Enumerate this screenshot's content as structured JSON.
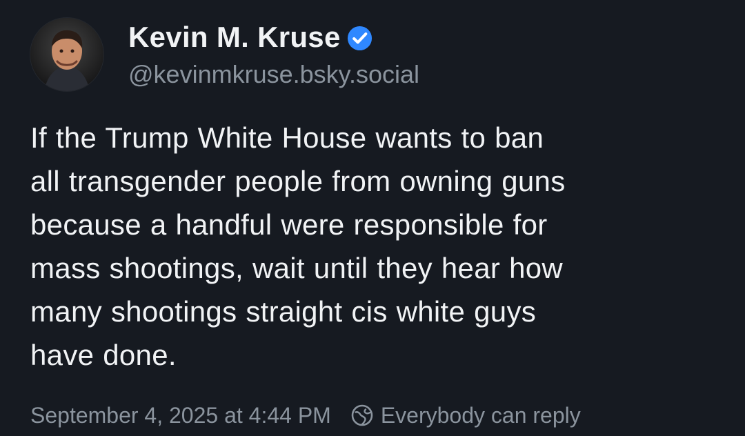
{
  "post": {
    "author": {
      "display_name": "Kevin M. Kruse",
      "handle": "@kevinmkruse.bsky.social",
      "verified": true,
      "verified_color": "#2f88ff"
    },
    "text_lines": [
      "If the Trump White House wants to ban",
      "all transgender people from owning guns",
      "because a handful were responsible for",
      "mass shootings, wait until they hear how",
      "many shootings straight cis white guys",
      "have done."
    ],
    "timestamp": "September 4, 2025 at 4:44 PM",
    "reply_setting": "Everybody can reply",
    "icons": {
      "avatar": "avatar-photo",
      "verified": "verified-check-icon",
      "reply_setting": "globe-icon"
    }
  },
  "theme": {
    "background": "#161a21",
    "text": "#f1f3f5",
    "muted": "#8b949e"
  }
}
